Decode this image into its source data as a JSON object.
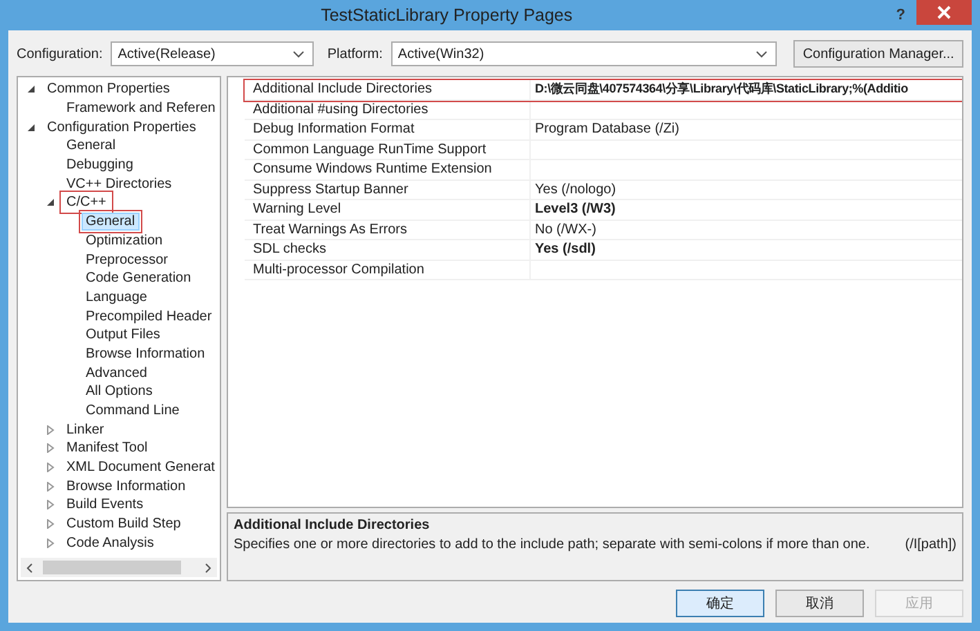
{
  "window": {
    "title": "TestStaticLibrary Property Pages",
    "help": "?"
  },
  "toolbar": {
    "configuration": {
      "label": "Configuration:",
      "value": "Active(Release)"
    },
    "platform": {
      "label": "Platform:",
      "value": "Active(Win32)"
    },
    "manager_button": "Configuration Manager..."
  },
  "tree": [
    {
      "label": "Common Properties",
      "expanded": true,
      "selected": false,
      "outlined": false,
      "children": [
        {
          "label": "Framework and Referen",
          "selected": false,
          "outlined": false
        }
      ]
    },
    {
      "label": "Configuration Properties",
      "expanded": true,
      "selected": false,
      "outlined": false,
      "children": [
        {
          "label": "General",
          "selected": false,
          "outlined": false
        },
        {
          "label": "Debugging",
          "selected": false,
          "outlined": false
        },
        {
          "label": "VC++ Directories",
          "selected": false,
          "outlined": false
        },
        {
          "label": "C/C++",
          "expanded": true,
          "selected": false,
          "outlined": true,
          "children": [
            {
              "label": "General",
              "selected": true,
              "outlined": true
            },
            {
              "label": "Optimization",
              "selected": false,
              "outlined": false
            },
            {
              "label": "Preprocessor",
              "selected": false,
              "outlined": false
            },
            {
              "label": "Code Generation",
              "selected": false,
              "outlined": false
            },
            {
              "label": "Language",
              "selected": false,
              "outlined": false
            },
            {
              "label": "Precompiled Header",
              "selected": false,
              "outlined": false
            },
            {
              "label": "Output Files",
              "selected": false,
              "outlined": false
            },
            {
              "label": "Browse Information",
              "selected": false,
              "outlined": false
            },
            {
              "label": "Advanced",
              "selected": false,
              "outlined": false
            },
            {
              "label": "All Options",
              "selected": false,
              "outlined": false
            },
            {
              "label": "Command Line",
              "selected": false,
              "outlined": false
            }
          ]
        },
        {
          "label": "Linker",
          "expanded": false,
          "selected": false,
          "outlined": false
        },
        {
          "label": "Manifest Tool",
          "expanded": false,
          "selected": false,
          "outlined": false
        },
        {
          "label": "XML Document Generat",
          "expanded": false,
          "selected": false,
          "outlined": false
        },
        {
          "label": "Browse Information",
          "expanded": false,
          "selected": false,
          "outlined": false
        },
        {
          "label": "Build Events",
          "expanded": false,
          "selected": false,
          "outlined": false
        },
        {
          "label": "Custom Build Step",
          "expanded": false,
          "selected": false,
          "outlined": false
        },
        {
          "label": "Code Analysis",
          "expanded": false,
          "selected": false,
          "outlined": false
        }
      ]
    }
  ],
  "properties": [
    {
      "name": "Additional Include Directories",
      "value": "D:\\微云同盘\\407574364\\分享\\Library\\代码库\\StaticLibrary;%(Additio",
      "bold": true,
      "outlined": true
    },
    {
      "name": "Additional #using Directories",
      "outlined": false
    },
    {
      "name": "Debug Information Format",
      "value": "Program Database (/Zi)",
      "bold": false,
      "outlined": false
    },
    {
      "name": "Common Language RunTime Support",
      "outlined": false
    },
    {
      "name": "Consume Windows Runtime Extension",
      "outlined": false
    },
    {
      "name": "Suppress Startup Banner",
      "value": "Yes (/nologo)",
      "bold": false,
      "outlined": false
    },
    {
      "name": "Warning Level",
      "value": "Level3 (/W3)",
      "bold": true,
      "outlined": false
    },
    {
      "name": "Treat Warnings As Errors",
      "value": "No (/WX-)",
      "bold": false,
      "outlined": false
    },
    {
      "name": "SDL checks",
      "value": "Yes (/sdl)",
      "bold": true,
      "outlined": false
    },
    {
      "name": "Multi-processor Compilation",
      "outlined": false
    }
  ],
  "description": {
    "title": "Additional Include Directories",
    "text": "Specifies one or more directories to add to the include path; separate with semi-colons if more than one.",
    "switch": "(/I[path])"
  },
  "buttons": [
    {
      "label": "确定",
      "disabled": false,
      "default": true
    },
    {
      "label": "取消",
      "disabled": false,
      "default": false
    },
    {
      "label": "应用",
      "disabled": true,
      "default": false
    }
  ]
}
